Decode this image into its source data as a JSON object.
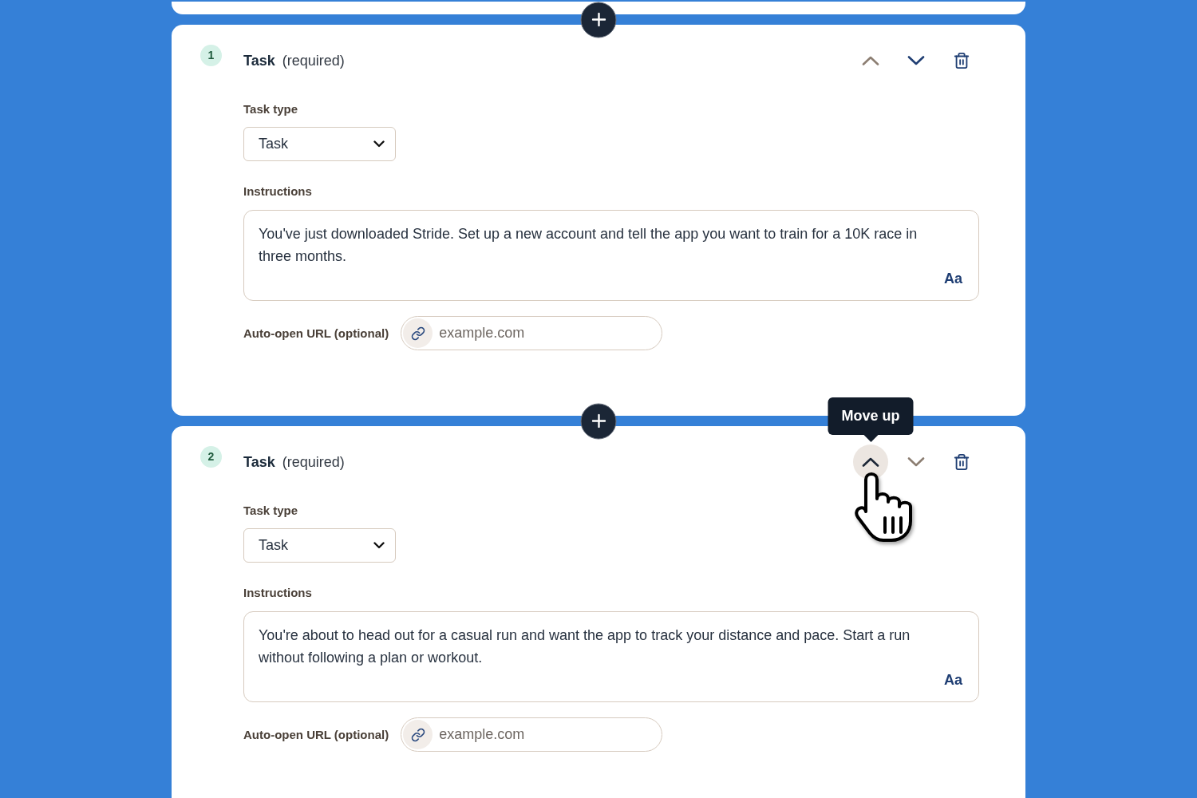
{
  "tasks": [
    {
      "number": "1",
      "title": "Task",
      "required_note": "(required)",
      "move_up": {
        "disabled": true,
        "hovered": false
      },
      "move_down": {
        "disabled": false,
        "hovered": false
      },
      "task_type": {
        "label": "Task type",
        "value": "Task"
      },
      "instructions": {
        "label": "Instructions",
        "value": "You've just downloaded Stride. Set up a new account and tell the app you want to train for a 10K race in three months.",
        "format_button": "Aa"
      },
      "auto_open_url": {
        "label": "Auto-open URL (optional)",
        "placeholder": "example.com"
      }
    },
    {
      "number": "2",
      "title": "Task",
      "required_note": "(required)",
      "move_up": {
        "disabled": false,
        "hovered": true,
        "tooltip": "Move up"
      },
      "move_down": {
        "disabled": true,
        "hovered": false
      },
      "task_type": {
        "label": "Task type",
        "value": "Task"
      },
      "instructions": {
        "label": "Instructions",
        "value": "You're about to head out for a casual run and want the app to track your distance and pace. Start a run without following a plan or workout.",
        "format_button": "Aa"
      },
      "auto_open_url": {
        "label": "Auto-open URL (optional)",
        "placeholder": "example.com"
      }
    }
  ]
}
